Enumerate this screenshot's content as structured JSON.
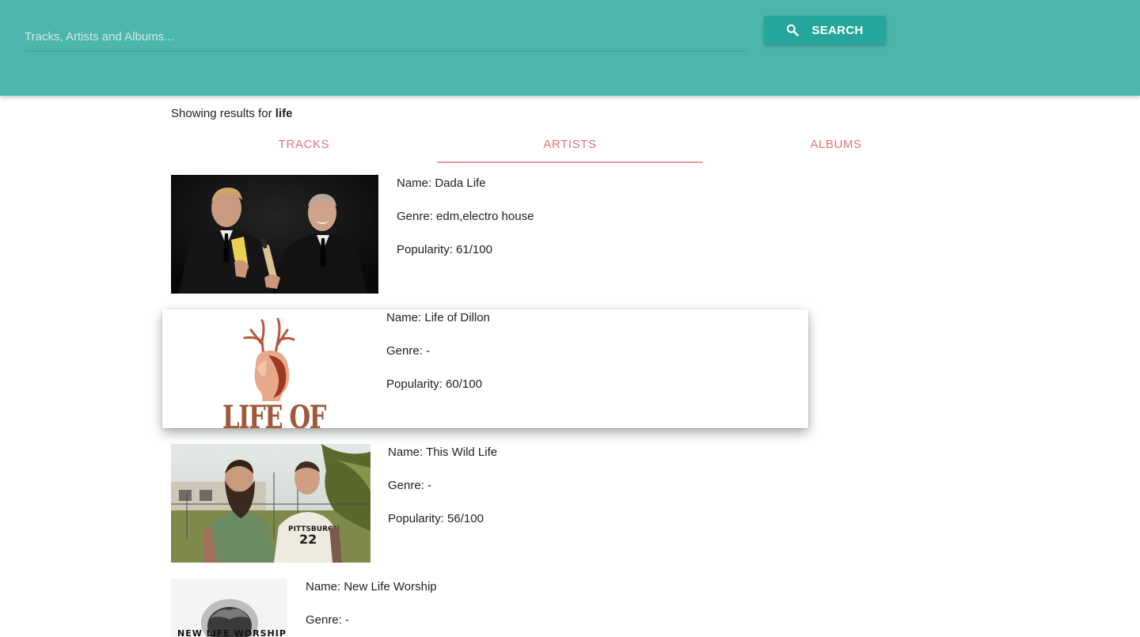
{
  "search": {
    "placeholder": "Tracks, Artists and Albums...",
    "value": "",
    "button_label": "SEARCH",
    "button_icon": "search-icon"
  },
  "results": {
    "prefix": "Showing results for ",
    "query": "life"
  },
  "tabs": [
    {
      "label": "TRACKS",
      "active": false
    },
    {
      "label": "ARTISTS",
      "active": true
    },
    {
      "label": "ALBUMS",
      "active": false
    }
  ],
  "artists": [
    {
      "name": "Name: Dada Life",
      "genre": "Genre: edm,electro house",
      "popularity": "Popularity: 61/100"
    },
    {
      "name": "Name: Life of Dillon",
      "genre": "Genre: -",
      "popularity": "Popularity: 60/100"
    },
    {
      "name": "Name: This Wild Life",
      "genre": "Genre: -",
      "popularity": "Popularity: 56/100"
    },
    {
      "name": "Name: New Life Worship",
      "genre": "Genre: -",
      "popularity": ""
    }
  ],
  "colors": {
    "header": "#4db6ac",
    "button": "#26a69a",
    "tab_text": "#e57373",
    "tab_indicator": "#ef9a9a"
  },
  "image_text": {
    "life_of_dillon_logo": "LIFE OF",
    "new_life_worship_logo": "NEW LIFE WORSHIP",
    "jersey_text": "PITTSBURGH 22"
  }
}
